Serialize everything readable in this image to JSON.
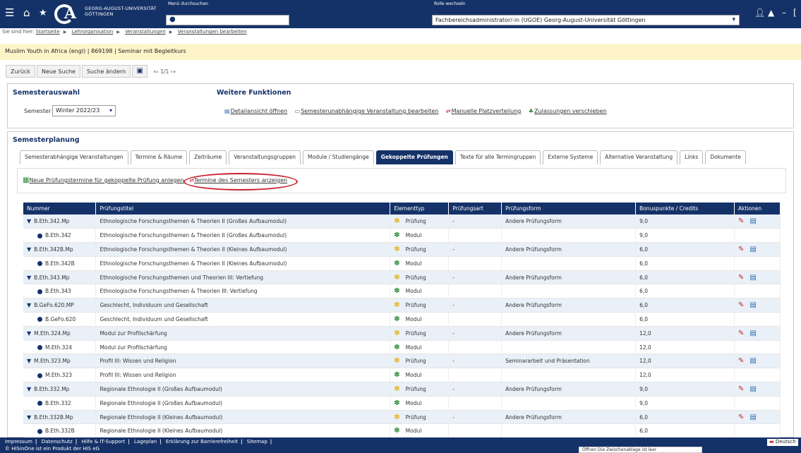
{
  "header": {
    "university": [
      "GEORG-AUGUST-UNIVERSITÄT",
      "GÖTTINGEN"
    ],
    "menu_label": "Menü durchsuchen",
    "role_label": "Rolle wechseln",
    "role_value": "Fachbereichsadministrator/-in (UGOE) Georg-August-Universität Göttingen",
    "accent": "#153268"
  },
  "breadcrumb": {
    "prefix": "Sie sind hier:",
    "items": [
      "Startseite",
      "Lehrorganisation",
      "Veranstaltungen",
      "Veranstaltungen bearbeiten"
    ]
  },
  "title": "Muslim Youth in Africa (engl) | 869198 | Seminar mit Begleitkurs",
  "nav": {
    "back": "Zurück",
    "new_search": "Neue Suche",
    "change_search": "Suche ändern",
    "pager": "«‹  1/1  ›»"
  },
  "semester": {
    "heading": "Semesterauswahl",
    "label": "Semester",
    "value": "Winter 2022/23"
  },
  "functions": {
    "heading": "Weitere Funktionen",
    "links": [
      "Detailansicht öffnen",
      "Semesterunabhängige Veranstaltung bearbeiten",
      "Manuelle Platzverteilung",
      "Zulassungen verschieben"
    ]
  },
  "planning": {
    "heading": "Semesterplanung",
    "tabs": [
      "Semesterabhängige Veranstaltungen",
      "Termine & Räume",
      "Zeiträume",
      "Veranstaltungsgruppen",
      "Module / Studiengänge",
      "Gekoppelte Prüfungen",
      "Texte für alle Termingruppen",
      "Externe Systeme",
      "Alternative Veranstaltung",
      "Links",
      "Dokumente"
    ],
    "active_tab": "Gekoppelte Prüfungen"
  },
  "actions": {
    "new_dates": "Neue Prüfungstermine für gekoppelte Prüfung anlegen",
    "show_dates": "Termine des Semesters anzeigen"
  },
  "table": {
    "headers": [
      "Nummer",
      "Prüfungstitel",
      "Elementtyp",
      "Prüfungsart",
      "Prüfungsform",
      "Bonuspunkte / Credits",
      "Aktionen"
    ],
    "rows": [
      {
        "kind": "parent",
        "number": "B.Eth.342.Mp",
        "title": "Ethnologische Forschungsthemen & Theorien II (Großes Aufbaumodul)",
        "type": "Prüfung",
        "art": "-",
        "form": "Andere Prüfungsform",
        "credits": "9,0"
      },
      {
        "kind": "child",
        "number": "B.Eth.342",
        "title": "Ethnologische Forschungsthemen & Theorien II (Großes Aufbaumodul)",
        "type": "Modul",
        "art": "",
        "form": "",
        "credits": "9,0"
      },
      {
        "kind": "parent",
        "number": "B.Eth.342B.Mp",
        "title": "Ethnologische Forschungsthemen & Theorien II (Kleines Aufbaumodul)",
        "type": "Prüfung",
        "art": "-",
        "form": "Andere Prüfungsform",
        "credits": "6,0"
      },
      {
        "kind": "child",
        "number": "B.Eth.342B",
        "title": "Ethnologische Forschungsthemen & Theorien II (Kleines Aufbaumodul)",
        "type": "Modul",
        "art": "",
        "form": "",
        "credits": "6,0"
      },
      {
        "kind": "parent",
        "number": "B.Eth.343.Mp",
        "title": "Ethnologische Forschungsthemen und Theorien III: Vertiefung",
        "type": "Prüfung",
        "art": "-",
        "form": "Andere Prüfungsform",
        "credits": "6,0"
      },
      {
        "kind": "child",
        "number": "B.Eth.343",
        "title": "Ethnologische Forschungsthemen & Theorien III: Vertiefung",
        "type": "Modul",
        "art": "",
        "form": "",
        "credits": "6,0"
      },
      {
        "kind": "parent",
        "number": "B.GeFo.620.MP",
        "title": "Geschlecht, Individuum und Gesellschaft",
        "type": "Prüfung",
        "art": "-",
        "form": "Andere Prüfungsform",
        "credits": "6,0"
      },
      {
        "kind": "child",
        "number": "B.GeFo.620",
        "title": "Geschlecht, Individuum und Gesellschaft",
        "type": "Modul",
        "art": "",
        "form": "",
        "credits": "6,0"
      },
      {
        "kind": "parent",
        "number": "M.Eth.324.Mp",
        "title": "Modul zur Profilschärfung",
        "type": "Prüfung",
        "art": "-",
        "form": "Andere Prüfungsform",
        "credits": "12,0"
      },
      {
        "kind": "child",
        "number": "M.Eth.324",
        "title": "Modul zur Profilschärfung",
        "type": "Modul",
        "art": "",
        "form": "",
        "credits": "12,0"
      },
      {
        "kind": "parent",
        "number": "M.Eth.323.Mp",
        "title": "Profil III: Wissen und Religion",
        "type": "Prüfung",
        "art": "-",
        "form": "Seminararbeit und Präsentation",
        "credits": "12,0"
      },
      {
        "kind": "child",
        "number": "M.Eth.323",
        "title": "Profil III: Wissen und Religion",
        "type": "Modul",
        "art": "",
        "form": "",
        "credits": "12,0"
      },
      {
        "kind": "parent",
        "number": "B.Eth.332.Mp",
        "title": "Regionale Ethnologie II (Großes Aufbaumodul)",
        "type": "Prüfung",
        "art": "-",
        "form": "Andere Prüfungsform",
        "credits": "9,0"
      },
      {
        "kind": "child",
        "number": "B.Eth.332",
        "title": "Regionale Ethnologie II (Großes Aufbaumodul)",
        "type": "Modul",
        "art": "",
        "form": "",
        "credits": "9,0"
      },
      {
        "kind": "parent",
        "number": "B.Eth.332B.Mp",
        "title": "Regionale Ethnologie II (Kleines Aufbaumodul)",
        "type": "Prüfung",
        "art": "-",
        "form": "Andere Prüfungsform",
        "credits": "6,0"
      },
      {
        "kind": "child",
        "number": "B.Eth.332B",
        "title": "Regionale Ethnologie II (Kleines Aufbaumodul)",
        "type": "Modul",
        "art": "",
        "form": "",
        "credits": "6,0"
      }
    ]
  },
  "footer": {
    "links": [
      "Impressum",
      "Datenschutz",
      "Hilfe & IT-Support",
      "Lageplan",
      "Erklärung zur Barrierefreiheit",
      "Sitemap"
    ],
    "copyright": "© HISinOne ist ein Produkt der HIS eG",
    "language": "Deutsch",
    "clipboard_note": "Öffnen  Die Zwischenablage ist leer"
  }
}
